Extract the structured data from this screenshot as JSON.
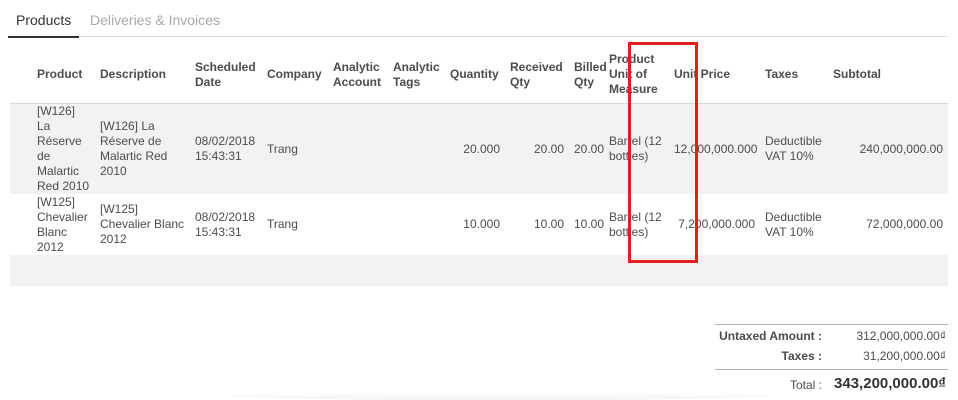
{
  "tabs": [
    {
      "label": "Products",
      "active": true
    },
    {
      "label": "Deliveries & Invoices",
      "active": false
    }
  ],
  "table": {
    "headers": {
      "product": "Product",
      "description": "Description",
      "scheduled_date": "Scheduled Date",
      "company": "Company",
      "analytic_account": "Analytic Account",
      "analytic_tags": "Analytic Tags",
      "quantity": "Quantity",
      "received_qty": "Received Qty",
      "billed_qty": "Billed Qty",
      "uom": "Product Unit of Measure",
      "unit_price": "Unit Price",
      "taxes": "Taxes",
      "subtotal": "Subtotal"
    },
    "rows": [
      {
        "product": "[W126] La Réserve de Malartic Red 2010",
        "description": "[W126] La Réserve de Malartic Red 2010",
        "scheduled_date": "08/02/2018 15:43:31",
        "company": "Trang",
        "analytic_account": "",
        "analytic_tags": "",
        "quantity": "20.000",
        "received_qty": "20.00",
        "billed_qty": "20.00",
        "uom": "Barrel (12 bottles)",
        "unit_price": "12,000,000.000",
        "taxes": "Deductible VAT 10%",
        "subtotal": "240,000,000.00"
      },
      {
        "product": "[W125] Chevalier Blanc 2012",
        "description": "[W125] Chevalier Blanc 2012",
        "scheduled_date": "08/02/2018 15:43:31",
        "company": "Trang",
        "analytic_account": "",
        "analytic_tags": "",
        "quantity": "10.000",
        "received_qty": "10.00",
        "billed_qty": "10.00",
        "uom": "Barrel (12 bottles)",
        "unit_price": "7,200,000.000",
        "taxes": "Deductible VAT 10%",
        "subtotal": "72,000,000.00"
      }
    ]
  },
  "totals": {
    "untaxed_label": "Untaxed Amount :",
    "untaxed_value": "312,000,000.00₫",
    "taxes_label": "Taxes :",
    "taxes_value": "31,200,000.00₫",
    "total_label": "Total :",
    "total_value": "343,200,000.00₫"
  },
  "colors": {
    "highlight": "#e02020",
    "row_shade": "#f2f2f2"
  }
}
